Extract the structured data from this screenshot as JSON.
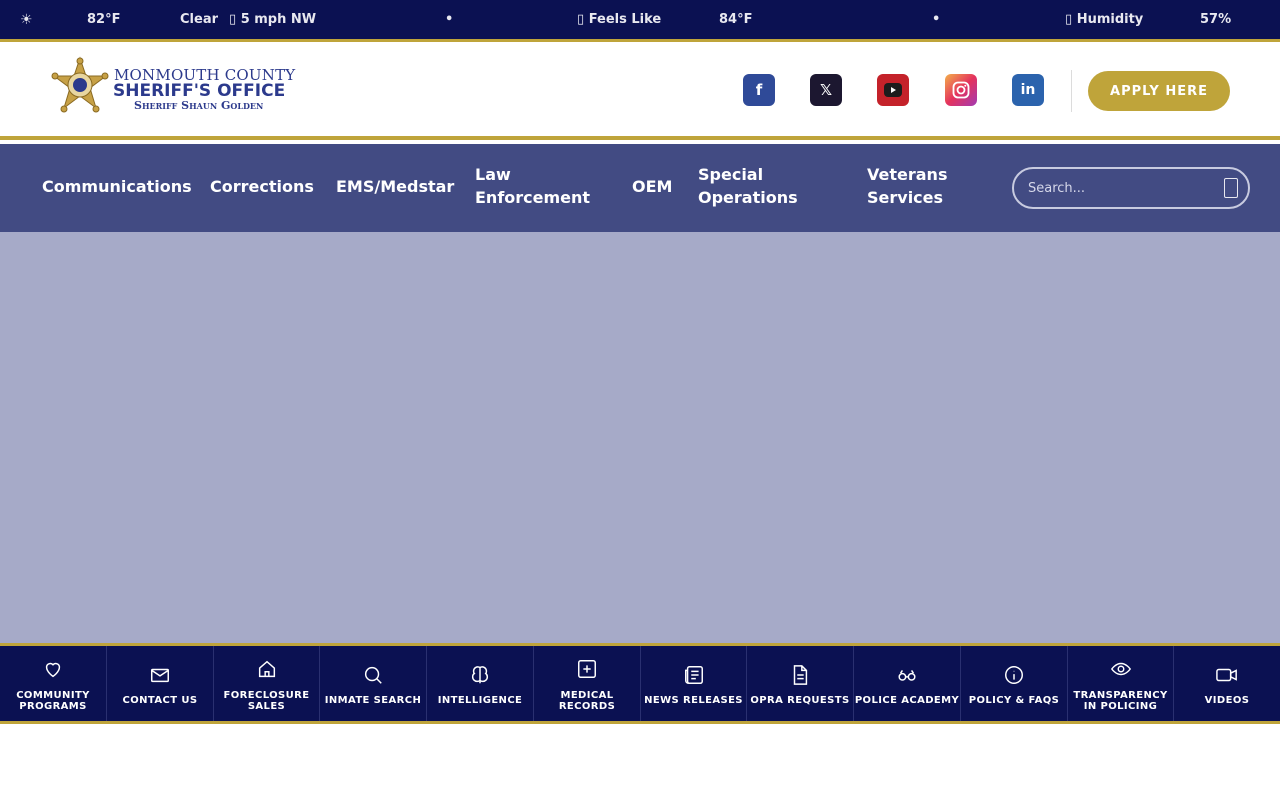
{
  "weather": {
    "sun_icon": "sun-icon",
    "temperature": "82°F",
    "condition": "Clear",
    "wind": "5 mph NW",
    "separator": "•",
    "feels_label": "Feels Like",
    "feels_value": "84°F",
    "humidity_label": "Humidity",
    "humidity_value": "57%"
  },
  "header": {
    "logo_line1": "MONMOUTH COUNTY",
    "logo_line2": "SHERIFF'S OFFICE",
    "logo_line3": "Sheriff Shaun Golden",
    "social": [
      {
        "name": "facebook-icon",
        "glyph": "f",
        "color": "#2f4a98"
      },
      {
        "name": "x-icon",
        "glyph": "𝕏",
        "color": "#1c1730"
      },
      {
        "name": "youtube-icon",
        "glyph": "▶",
        "color": "#c4222a"
      },
      {
        "name": "instagram-icon",
        "glyph": "◎",
        "color": "#e4325d"
      },
      {
        "name": "linkedin-icon",
        "glyph": "in",
        "color": "#2b63ad"
      }
    ],
    "apply_label": "APPLY HERE"
  },
  "nav": {
    "items": [
      {
        "line1": "Communications",
        "line2": ""
      },
      {
        "line1": "Corrections",
        "line2": ""
      },
      {
        "line1": "EMS/Medstar",
        "line2": ""
      },
      {
        "line1": "Law",
        "line2": "Enforcement"
      },
      {
        "line1": "OEM",
        "line2": ""
      },
      {
        "line1": "Special",
        "line2": "Operations"
      },
      {
        "line1": "Veterans",
        "line2": "Services"
      }
    ],
    "search_placeholder": "Search..."
  },
  "quick_links": [
    {
      "line1": "COMMUNITY",
      "line2": "PROGRAMS",
      "icon": "heart-icon"
    },
    {
      "line1": "CONTACT US",
      "line2": "",
      "icon": "mail-icon"
    },
    {
      "line1": "FORECLOSURE",
      "line2": "SALES",
      "icon": "home-icon"
    },
    {
      "line1": "INMATE SEARCH",
      "line2": "",
      "icon": "search-icon"
    },
    {
      "line1": "INTELLIGENCE",
      "line2": "",
      "icon": "brain-icon"
    },
    {
      "line1": "MEDICAL",
      "line2": "RECORDS",
      "icon": "medical-plus-icon"
    },
    {
      "line1": "NEWS RELEASES",
      "line2": "",
      "icon": "newspaper-icon"
    },
    {
      "line1": "OPRA REQUESTS",
      "line2": "",
      "icon": "document-icon"
    },
    {
      "line1": "POLICE ACADEMY",
      "line2": "",
      "icon": "glasses-icon"
    },
    {
      "line1": "POLICY & FAQS",
      "line2": "",
      "icon": "info-icon"
    },
    {
      "line1": "TRANSPARENCY",
      "line2": "IN POLICING",
      "icon": "eye-icon"
    },
    {
      "line1": "VIDEOS",
      "line2": "",
      "icon": "video-icon"
    }
  ],
  "colors": {
    "navy": "#0b1152",
    "nav_blue": "#424b83",
    "gold": "#bfa43a",
    "hero": "#a6aac8"
  }
}
